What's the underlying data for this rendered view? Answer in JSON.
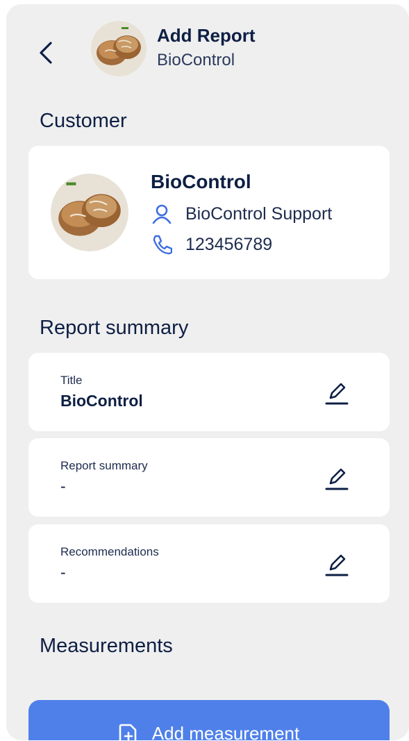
{
  "header": {
    "back_icon": "chevron-left-icon",
    "title": "Add Report",
    "subtitle": "BioControl",
    "avatar_icon": "bread-avatar"
  },
  "customer_section": {
    "heading": "Customer",
    "card": {
      "name": "BioControl",
      "contact": "BioControl Support",
      "contact_icon": "user-icon",
      "phone": "123456789",
      "phone_icon": "phone-icon"
    }
  },
  "report_summary_section": {
    "heading": "Report summary",
    "fields": [
      {
        "label": "Title",
        "value": "BioControl",
        "edit_icon": "pencil-icon"
      },
      {
        "label": "Report summary",
        "value": "-",
        "edit_icon": "pencil-icon"
      },
      {
        "label": "Recommendations",
        "value": "-",
        "edit_icon": "pencil-icon"
      }
    ]
  },
  "measurements_section": {
    "heading": "Measurements",
    "add_button_label": "Add measurement",
    "add_button_icon": "file-plus-icon"
  },
  "colors": {
    "background": "#efefef",
    "card": "#ffffff",
    "text_primary": "#0e1f44",
    "accent_blue": "#4f80ea",
    "icon_blue": "#3d6ee0"
  }
}
